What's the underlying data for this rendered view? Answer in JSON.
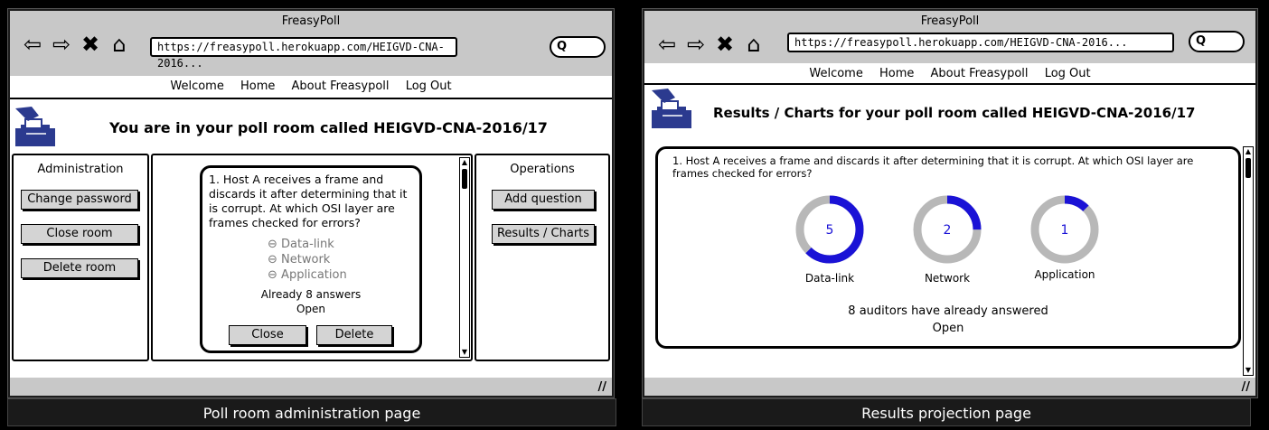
{
  "left": {
    "window_title": "FreasyPoll",
    "nav_glyphs": [
      "⇦",
      "⇨",
      "✖",
      "⌂"
    ],
    "url": "https://freasypoll.herokuapp.com/HEIGVD-CNA-2016...",
    "search_glyph": "Q",
    "menu": [
      "Welcome",
      "Home",
      "About Freasypoll",
      "Log Out"
    ],
    "heading": "You are in your poll room called HEIGVD-CNA-2016/17",
    "admin": {
      "title": "Administration",
      "buttons": [
        "Change password",
        "Close room",
        "Delete room"
      ]
    },
    "question": {
      "text": "1. Host A receives a frame and discards it after determining that it is corrupt. At which OSI layer are frames checked for errors?",
      "options": [
        "Data-link",
        "Network",
        "Application"
      ],
      "option_glyph": "⊖",
      "answers": "Already 8 answers",
      "status": "Open",
      "close_label": "Close",
      "delete_label": "Delete"
    },
    "operations": {
      "title": "Operations",
      "buttons": [
        "Add question",
        "Results / Charts"
      ]
    },
    "caption": "Poll room administration page"
  },
  "right": {
    "window_title": "FreasyPoll",
    "nav_glyphs": [
      "⇦",
      "⇨",
      "✖",
      "⌂"
    ],
    "url": "https://freasypoll.herokuapp.com/HEIGVD-CNA-2016...",
    "search_glyph": "Q",
    "menu": [
      "Welcome",
      "Home",
      "About Freasypoll",
      "Log Out"
    ],
    "heading": "Results / Charts for your poll room called HEIGVD-CNA-2016/17",
    "question_text": "1. Host A receives a frame and discards it after determining that it is corrupt. At which OSI layer are frames checked for errors?",
    "results": [
      {
        "label": "Data-link",
        "count": "5",
        "share": 0.625
      },
      {
        "label": "Network",
        "count": "2",
        "share": 0.25
      },
      {
        "label": "Application",
        "count": "1",
        "share": 0.125
      }
    ],
    "answered": "8 auditors have already answered",
    "status": "Open",
    "caption": "Results projection page"
  },
  "colors": {
    "accent": "#1a12d6",
    "ring": "#b8b8b8",
    "chrome": "#c8c8c8",
    "button": "#d4d4d4",
    "logo": "#2b3a8f"
  },
  "scroll_glyphs": {
    "up": "▲",
    "down": "▼"
  },
  "grip_glyph": "//"
}
